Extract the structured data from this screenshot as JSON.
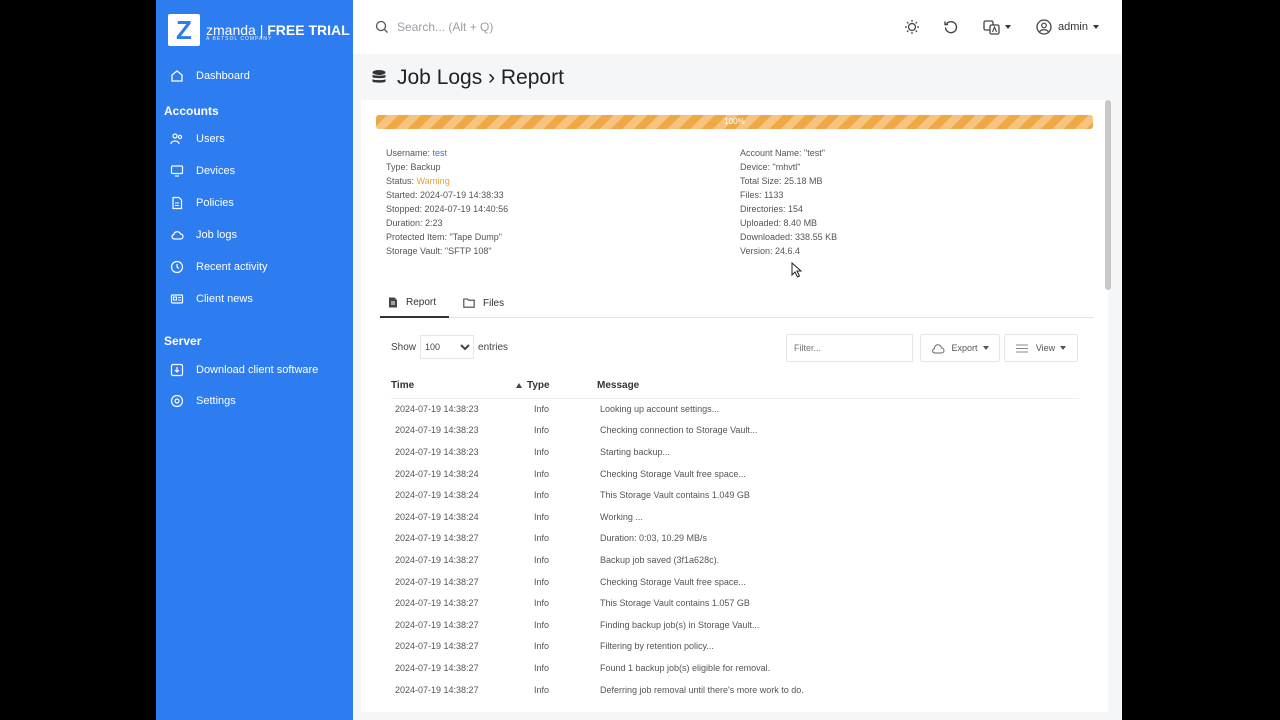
{
  "brand": {
    "name": "zmanda",
    "suffix": "FREE TRIAL",
    "tagline": "A BETSOL COMPANY"
  },
  "sidebar": {
    "items": [
      {
        "label": "Dashboard",
        "icon": "home-icon"
      },
      {
        "section": "Accounts"
      },
      {
        "label": "Users",
        "icon": "users-icon"
      },
      {
        "label": "Devices",
        "icon": "monitor-icon"
      },
      {
        "label": "Policies",
        "icon": "document-icon"
      },
      {
        "label": "Job logs",
        "icon": "cloud-icon"
      },
      {
        "label": "Recent activity",
        "icon": "clock-icon"
      },
      {
        "label": "Client news",
        "icon": "news-icon"
      },
      {
        "section": "Server"
      },
      {
        "label": "Download client software",
        "icon": "download-icon"
      },
      {
        "label": "Settings",
        "icon": "gear-icon"
      }
    ]
  },
  "topbar": {
    "search_placeholder": "Search... (Alt + Q)",
    "user": "admin"
  },
  "page": {
    "title": "Job Logs › Report"
  },
  "progress": {
    "value": 1.0,
    "label": "100%"
  },
  "details_left": [
    {
      "k": "Username: ",
      "v": "test",
      "style": "link"
    },
    {
      "k": "Type: ",
      "v": "Backup"
    },
    {
      "k": "Status: ",
      "v": "Warning",
      "style": "warn"
    },
    {
      "k": "Started: ",
      "v": "2024-07-19 14:38:33"
    },
    {
      "k": "Stopped: ",
      "v": "2024-07-19 14:40:56"
    },
    {
      "k": "Duration: ",
      "v": "2:23"
    },
    {
      "k": "Protected Item: ",
      "v": "\"Tape Dump\""
    },
    {
      "k": "Storage Vault: ",
      "v": "\"SFTP 108\""
    }
  ],
  "details_right": [
    {
      "k": "Account Name: ",
      "v": "\"test\""
    },
    {
      "k": "Device: ",
      "v": "\"mhvtl\""
    },
    {
      "k": "Total Size: ",
      "v": "25.18 MB"
    },
    {
      "k": "Files: ",
      "v": "1133"
    },
    {
      "k": "Directories: ",
      "v": "154"
    },
    {
      "k": "Uploaded: ",
      "v": "8.40 MB"
    },
    {
      "k": "Downloaded: ",
      "v": "338.55 KB"
    },
    {
      "k": "Version: ",
      "v": "24.6.4"
    }
  ],
  "tabs": [
    {
      "label": "Report",
      "icon": "report-icon"
    },
    {
      "label": "Files",
      "icon": "folder-icon"
    }
  ],
  "controls": {
    "show_label": "Show",
    "page_size": "100",
    "entries_label": "entries",
    "filter_placeholder": "Filter...",
    "export_label": "Export",
    "view_label": "View"
  },
  "table": {
    "columns": [
      "Time",
      "Type",
      "Message"
    ],
    "rows": [
      [
        "2024-07-19 14:38:23",
        "Info",
        "Looking up account settings..."
      ],
      [
        "2024-07-19 14:38:23",
        "Info",
        "Checking connection to Storage Vault..."
      ],
      [
        "2024-07-19 14:38:23",
        "Info",
        "Starting backup..."
      ],
      [
        "2024-07-19 14:38:24",
        "Info",
        "Checking Storage Vault free space..."
      ],
      [
        "2024-07-19 14:38:24",
        "Info",
        "This Storage Vault contains 1.049 GB"
      ],
      [
        "2024-07-19 14:38:24",
        "Info",
        "Working ..."
      ],
      [
        "2024-07-19 14:38:27",
        "Info",
        "Duration: 0:03, 10.29 MB/s"
      ],
      [
        "2024-07-19 14:38:27",
        "Info",
        "Backup job saved (3f1a628c)."
      ],
      [
        "2024-07-19 14:38:27",
        "Info",
        "Checking Storage Vault free space..."
      ],
      [
        "2024-07-19 14:38:27",
        "Info",
        "This Storage Vault contains 1.057 GB"
      ],
      [
        "2024-07-19 14:38:27",
        "Info",
        "Finding backup job(s) in Storage Vault..."
      ],
      [
        "2024-07-19 14:38:27",
        "Info",
        "Filtering by retention policy..."
      ],
      [
        "2024-07-19 14:38:27",
        "Info",
        "Found 1 backup job(s) eligible for removal."
      ],
      [
        "2024-07-19 14:38:27",
        "Info",
        "Deferring job removal until there's more work to do."
      ]
    ]
  }
}
